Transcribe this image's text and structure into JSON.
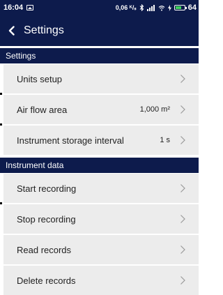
{
  "statusbar": {
    "time": "16:04",
    "network_speed": "0,06 ᴷ/ₛ",
    "battery_level": "64",
    "icons": [
      "gallery-icon",
      "bluetooth-icon",
      "signal-icon",
      "wifi-icon",
      "charging-icon",
      "battery-icon"
    ]
  },
  "appbar": {
    "title": "Settings",
    "back_icon": "back-arrow-icon"
  },
  "sections": [
    {
      "header": "Settings",
      "items": [
        {
          "label": "Units setup",
          "value": ""
        },
        {
          "label": "Air flow area",
          "value": "1,000 m²"
        },
        {
          "label": "Instrument storage interval",
          "value": "1 s"
        }
      ]
    },
    {
      "header": "Instrument data",
      "items": [
        {
          "label": "Start recording"
        },
        {
          "label": "Stop recording"
        },
        {
          "label": "Read records"
        },
        {
          "label": "Delete records"
        }
      ]
    }
  ],
  "colors": {
    "header_bg": "#0d1b4c",
    "row_bg": "#ececec",
    "chevron": "#9a9a9a",
    "battery_fill": "#3fd25c"
  }
}
